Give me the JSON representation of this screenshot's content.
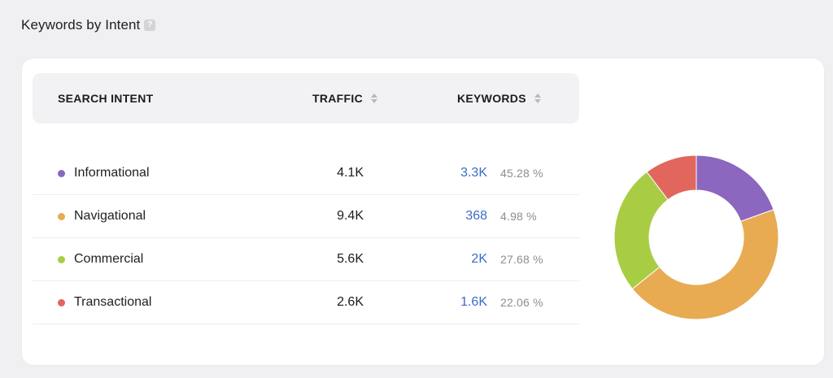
{
  "section": {
    "title": "Keywords by Intent",
    "help_glyph": "?"
  },
  "table": {
    "headers": {
      "intent": "SEARCH INTENT",
      "traffic": "TRAFFIC",
      "keywords": "KEYWORDS"
    },
    "rows": [
      {
        "intent": "Informational",
        "traffic": "4.1K",
        "keywords": "3.3K",
        "share": "45.28 %",
        "color": "#8b67c0"
      },
      {
        "intent": "Navigational",
        "traffic": "9.4K",
        "keywords": "368",
        "share": "4.98 %",
        "color": "#e8ab52"
      },
      {
        "intent": "Commercial",
        "traffic": "5.6K",
        "keywords": "2K",
        "share": "27.68 %",
        "color": "#a8cd44"
      },
      {
        "intent": "Transactional",
        "traffic": "2.6K",
        "keywords": "1.6K",
        "share": "22.06 %",
        "color": "#e0665e"
      }
    ]
  },
  "chart_data": {
    "type": "pie",
    "categories": [
      "Informational",
      "Navigational",
      "Commercial",
      "Transactional"
    ],
    "values": [
      19.5,
      44.7,
      25.5,
      10.3
    ],
    "colors": [
      "#8b67c0",
      "#e8ab52",
      "#a8cd44",
      "#e0665e"
    ],
    "donut": true
  }
}
